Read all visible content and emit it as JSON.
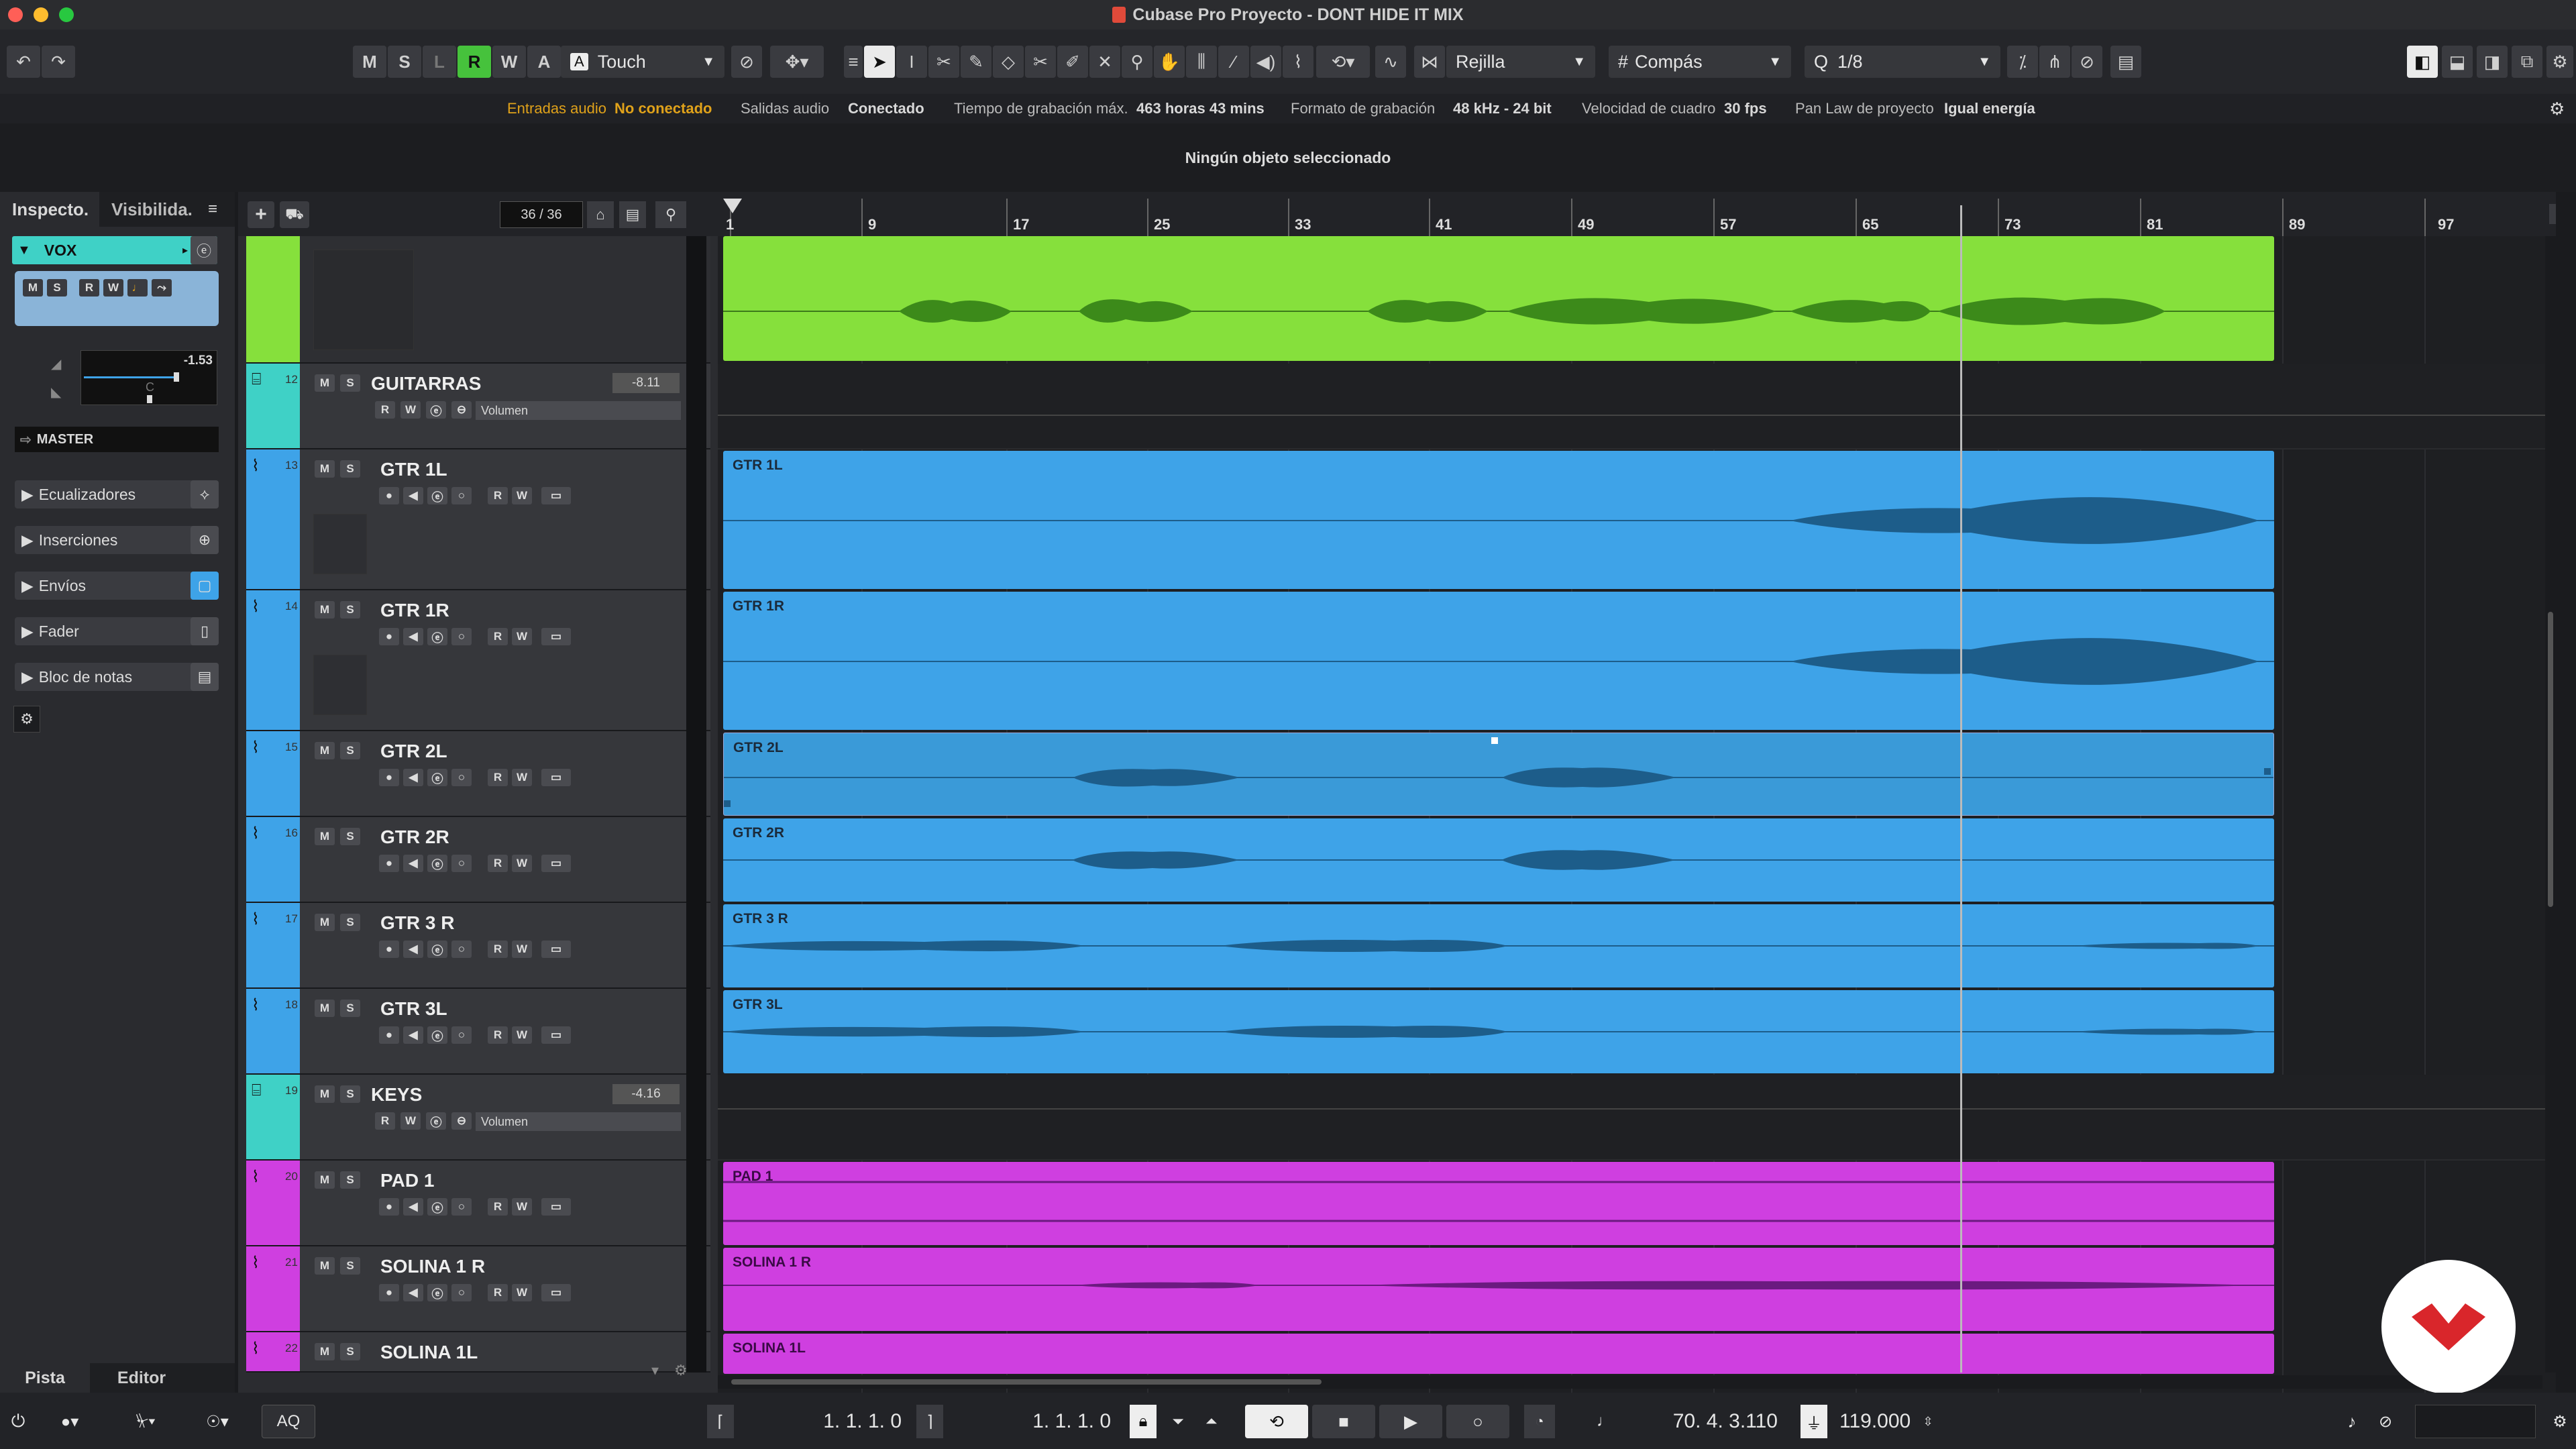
{
  "window": {
    "title": "Cubase Pro Proyecto - DONT HIDE IT MIX"
  },
  "toolbar": {
    "mode_buttons": [
      "M",
      "S",
      "L",
      "R",
      "W",
      "A"
    ],
    "automation_mode": "Touch",
    "snap_type": "Rejilla",
    "grid_type": "Compás",
    "quantize": "1/8"
  },
  "infobar": {
    "audio_inputs_label": "Entradas audio",
    "audio_inputs_value": "No conectado",
    "audio_outputs_label": "Salidas audio",
    "audio_outputs_value": "Conectado",
    "max_rec_label": "Tiempo de grabación máx.",
    "max_rec_value": "463 horas 43 mins",
    "rec_format_label": "Formato de grabación",
    "rec_format_value": "48 kHz - 24 bit",
    "framerate_label": "Velocidad de cuadro",
    "framerate_value": "30 fps",
    "panlaw_label": "Pan Law de proyecto",
    "panlaw_value": "Igual energía"
  },
  "status": {
    "message": "Ningún objeto seleccionado"
  },
  "inspector": {
    "tabs": [
      "Inspecto.",
      "Visibilida."
    ],
    "track_name": "VOX",
    "volume_value": "-1.53",
    "pan_value": "C",
    "output": "MASTER",
    "sections": [
      "Ecualizadores",
      "Inserciones",
      "Envíos",
      "Fader",
      "Bloc de notas"
    ],
    "bottom_tabs": [
      "Pista",
      "Editor"
    ]
  },
  "tracklist": {
    "count": "36 / 36",
    "tracks": [
      {
        "num": "12",
        "name": "GUITARRAS",
        "type": "folder",
        "vol": "-8.11",
        "param": "Volumen"
      },
      {
        "num": "13",
        "name": "GTR 1L",
        "type": "audio"
      },
      {
        "num": "14",
        "name": "GTR 1R",
        "type": "audio"
      },
      {
        "num": "15",
        "name": "GTR 2L",
        "type": "audio"
      },
      {
        "num": "16",
        "name": "GTR 2R",
        "type": "audio"
      },
      {
        "num": "17",
        "name": "GTR 3 R",
        "type": "audio"
      },
      {
        "num": "18",
        "name": "GTR 3L",
        "type": "audio"
      },
      {
        "num": "19",
        "name": "KEYS",
        "type": "folder",
        "vol": "-4.16",
        "param": "Volumen"
      },
      {
        "num": "20",
        "name": "PAD 1",
        "type": "audio"
      },
      {
        "num": "21",
        "name": "SOLINA 1 R",
        "type": "audio"
      },
      {
        "num": "22",
        "name": "SOLINA 1L",
        "type": "audio"
      }
    ]
  },
  "ruler": {
    "bars": [
      "1",
      "9",
      "17",
      "25",
      "33",
      "41",
      "49",
      "57",
      "65",
      "73",
      "81",
      "89",
      "97"
    ]
  },
  "events": [
    "GTR 1L",
    "GTR 1R",
    "GTR 2L",
    "GTR 2R",
    "GTR 3 R",
    "GTR 3L",
    "PAD 1",
    "SOLINA 1 R",
    "SOLINA 1L"
  ],
  "transport": {
    "left_locator": "1. 1. 1.   0",
    "right_locator": "1. 1. 1.   0",
    "position": "70. 4. 3.110",
    "tempo": "119.000",
    "aq": "AQ"
  },
  "colors": {
    "green": "#86e03c",
    "blue": "#3ea3e8",
    "magenta": "#cf3fe0",
    "teal": "#3fd1c6",
    "accent": "#e0a21a"
  }
}
